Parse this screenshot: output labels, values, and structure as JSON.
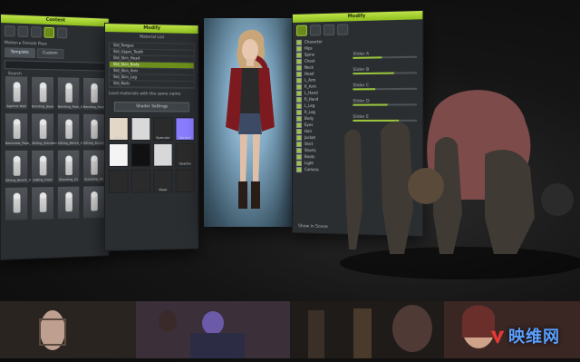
{
  "content_panel": {
    "title": "Content",
    "sub_label": "Motion ▸ Female Pose",
    "tabs": [
      "Template",
      "Custom"
    ],
    "search_placeholder": "Search",
    "items": [
      {
        "label": "Against Wall"
      },
      {
        "label": "Bending_Base"
      },
      {
        "label": "Bending_Pose_01"
      },
      {
        "label": "Bending_Pose_02"
      },
      {
        "label": "Backview_Pose_03"
      },
      {
        "label": "Sitting_Standard"
      },
      {
        "label": "Sitting_Bench_01"
      },
      {
        "label": "Sitting_Bench_02"
      },
      {
        "label": "Sitting_Bench_03"
      },
      {
        "label": "Sitting_Floor"
      },
      {
        "label": "Standing_01"
      },
      {
        "label": "Standing_02"
      },
      {
        "label": ""
      },
      {
        "label": ""
      },
      {
        "label": ""
      },
      {
        "label": ""
      }
    ]
  },
  "modify_panel": {
    "title": "Modify",
    "section": "Material List",
    "rows": [
      {
        "label": "Std_Tongue",
        "selected": false
      },
      {
        "label": "Std_Upper_Teeth",
        "selected": false
      },
      {
        "label": "Std_Skin_Head",
        "selected": false
      },
      {
        "label": "Std_Skin_Body",
        "selected": true
      },
      {
        "label": "Std_Skin_Arm",
        "selected": false
      },
      {
        "label": "Std_Skin_Leg",
        "selected": false
      },
      {
        "label": "Std_Nails",
        "selected": false
      }
    ],
    "note": "Load materials with the same name",
    "button": "Shader Settings",
    "materials": [
      {
        "label": "Base",
        "color": "#e3d7c7"
      },
      {
        "label": "",
        "color": "#d9d9d9"
      },
      {
        "label": "Specular",
        "color": "#2b2b2b"
      },
      {
        "label": "Normal",
        "color": "#8a7cff"
      },
      {
        "label": "",
        "color": "#f4f4f4"
      },
      {
        "label": "",
        "color": "#111111"
      },
      {
        "label": "",
        "color": "#d8d8d8"
      },
      {
        "label": "Opacity",
        "color": "#2b2b2b"
      },
      {
        "label": "",
        "color": "#2b2b2b"
      },
      {
        "label": "",
        "color": "#2b2b2b"
      },
      {
        "label": "Mask",
        "color": "#2b2b2b"
      },
      {
        "label": "",
        "color": "#2b2b2b"
      }
    ]
  },
  "scene_panel": {
    "title": "Modify",
    "toolbar_labels": [
      "Morph",
      "Animation"
    ],
    "items": [
      {
        "label": "Character",
        "checked": true
      },
      {
        "label": "Hips",
        "checked": true
      },
      {
        "label": "Spine",
        "checked": true
      },
      {
        "label": "Chest",
        "checked": true
      },
      {
        "label": "Neck",
        "checked": true
      },
      {
        "label": "Head",
        "checked": true
      },
      {
        "label": "L_Arm",
        "checked": true
      },
      {
        "label": "R_Arm",
        "checked": true
      },
      {
        "label": "L_Hand",
        "checked": true
      },
      {
        "label": "R_Hand",
        "checked": true
      },
      {
        "label": "L_Leg",
        "checked": true
      },
      {
        "label": "R_Leg",
        "checked": true
      },
      {
        "label": "Body",
        "checked": true
      },
      {
        "label": "Eyes",
        "checked": true
      },
      {
        "label": "Hair",
        "checked": true
      },
      {
        "label": "Jacket",
        "checked": true
      },
      {
        "label": "Shirt",
        "checked": true
      },
      {
        "label": "Shorts",
        "checked": true
      },
      {
        "label": "Boots",
        "checked": true
      },
      {
        "label": "Light",
        "checked": true
      },
      {
        "label": "Camera",
        "checked": true
      }
    ],
    "sliders": [
      {
        "label": "Slider A",
        "level": 0.45
      },
      {
        "label": "Slider B",
        "level": 0.65
      },
      {
        "label": "Slider C",
        "level": 0.35
      },
      {
        "label": "Slider D",
        "level": 0.55
      },
      {
        "label": "Slider E",
        "level": 0.72
      }
    ],
    "footer": "Show in Scene"
  },
  "bottom_strip": {
    "tiles": [
      {
        "name": "face-tile",
        "color": "#2a2420"
      },
      {
        "name": "woman-purple-tile",
        "color": "#3b2f3a"
      },
      {
        "name": "warrior-tile",
        "color": "#1e1b18"
      },
      {
        "name": "woman-portrait-tile",
        "color": "#3a2724"
      }
    ]
  },
  "watermark": {
    "text": "映维网",
    "color": "#5aa0ff"
  }
}
